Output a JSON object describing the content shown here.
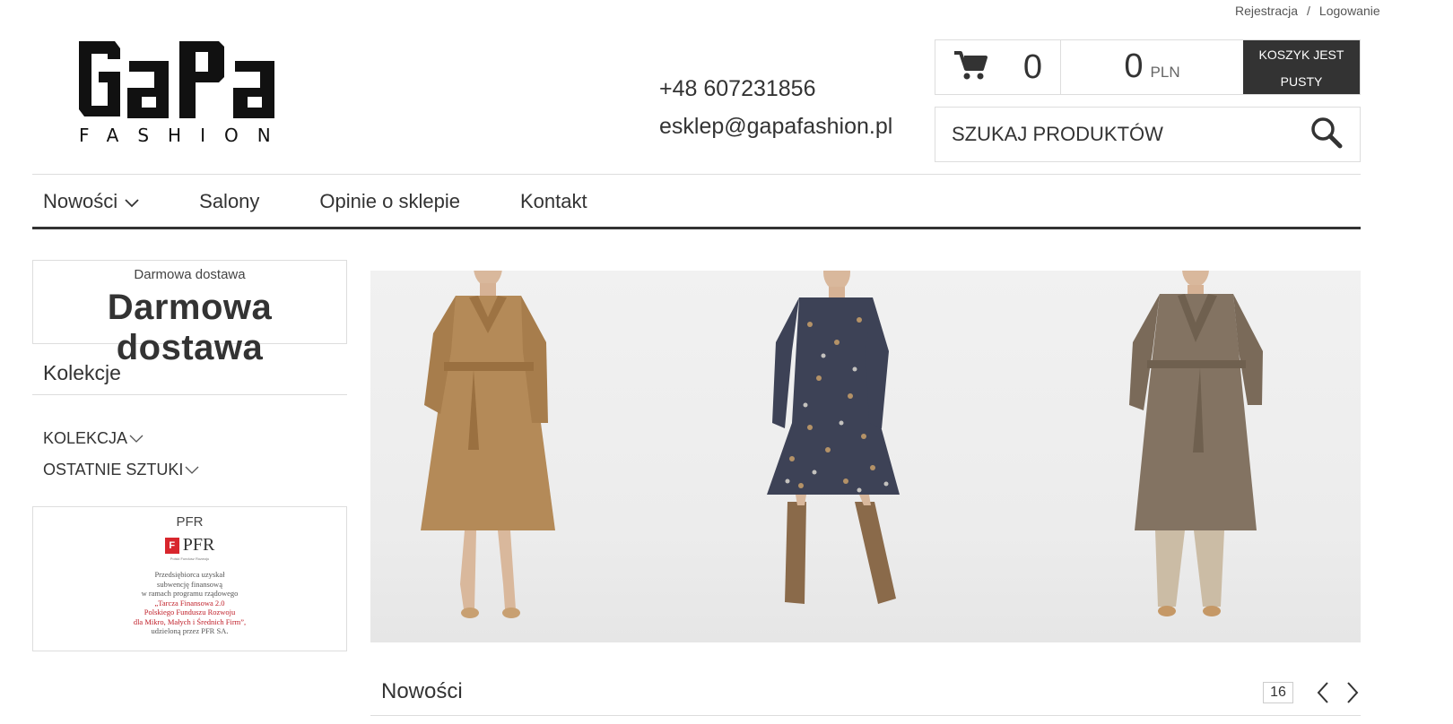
{
  "top_links": {
    "register": "Rejestracja",
    "separator": "/",
    "login": "Logowanie"
  },
  "logo": {
    "word": "GaPa",
    "subtitle": "FASHION"
  },
  "contact": {
    "phone": "+48 607231856",
    "email": "esklep@gapafashion.pl"
  },
  "cart": {
    "icon": "cart-icon",
    "count": "0",
    "total": "0",
    "currency": "PLN",
    "status_line1": "KOSZYK JEST",
    "status_line2": "PUSTY"
  },
  "search": {
    "placeholder": "SZUKAJ PRODUKTÓW",
    "icon": "search-icon"
  },
  "nav": {
    "items": [
      {
        "label": "Nowości"
      },
      {
        "label": "Salony"
      },
      {
        "label": "Opinie o sklepie"
      },
      {
        "label": "Kontakt"
      }
    ]
  },
  "sidebar": {
    "promo_small": "Darmowa dostawa",
    "promo_big": "Darmowa dostawa",
    "collections_title": "Kolekcje",
    "collections": [
      {
        "label": "KOLEKCJA"
      },
      {
        "label": "OSTATNIE SZTUKI"
      }
    ],
    "pfr_title": "PFR",
    "pfr_logo_text": "PFR",
    "pfr_logo_sub": "Polski Fundusz Rozwoju",
    "pfr_lines": [
      "Przedsiębiorca uzyskał",
      "subwencję finansową",
      "w ramach programu rządowego",
      "„Tarcza Finansowa 2.0",
      "Polskiego Funduszu Rozwoju",
      "dla Mikro, Małych i Średnich Firm”,",
      "udzieloną przez PFR SA."
    ]
  },
  "news": {
    "title": "Nowości",
    "count": "16"
  },
  "colors": {
    "accent_dark": "#333333",
    "border": "#dddddd",
    "pfr_red": "#c0202a"
  }
}
